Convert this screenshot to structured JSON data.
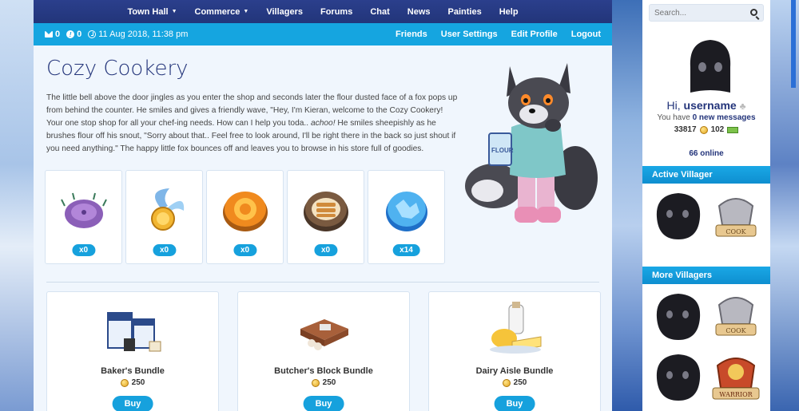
{
  "nav": {
    "items": [
      {
        "label": "Town Hall",
        "dropdown": true
      },
      {
        "label": "Commerce",
        "dropdown": true
      },
      {
        "label": "Villagers",
        "dropdown": false
      },
      {
        "label": "Forums",
        "dropdown": false
      },
      {
        "label": "Chat",
        "dropdown": false
      },
      {
        "label": "News",
        "dropdown": false
      },
      {
        "label": "Painties",
        "dropdown": false
      },
      {
        "label": "Help",
        "dropdown": false
      }
    ]
  },
  "subbar": {
    "messages_count": "0",
    "alerts_count": "0",
    "datetime": "11 Aug 2018, 11:38 pm",
    "links": [
      "Friends",
      "User Settings",
      "Edit Profile",
      "Logout"
    ]
  },
  "shop": {
    "title": "Cozy Cookery",
    "intro_1": "The little bell above the door jingles as you enter the shop and seconds later the flour dusted face of a fox pops up from behind the counter. He smiles and gives a friendly wave, \"Hey, I'm Kieran, welcome to the Cozy Cookery! Your one stop shop for all your chef-ing needs. How can I help you toda.. ",
    "intro_sneeze": "achoo!",
    "intro_2": " He smiles sheepishly as he brushes flour off his snout, \"Sorry about that.. Feel free to look around, I'll be right there in the back so just shout if you need anything.\" The happy little fox bounces off and leaves you to browse in his store full of goodies.",
    "items": [
      {
        "name": "sea-urchin-item",
        "count": "x0"
      },
      {
        "name": "winged-coin-item",
        "count": "x0"
      },
      {
        "name": "sun-coin-item",
        "count": "x0"
      },
      {
        "name": "cookie-coin-item",
        "count": "x0"
      },
      {
        "name": "ice-coin-item",
        "count": "x14"
      }
    ],
    "bundles": [
      {
        "name": "Baker's Bundle",
        "price": "250",
        "button": "Buy"
      },
      {
        "name": "Butcher's Block Bundle",
        "price": "250",
        "button": "Buy"
      },
      {
        "name": "Dairy Aisle Bundle",
        "price": "250",
        "button": "Buy"
      }
    ]
  },
  "sidebar": {
    "search_placeholder": "Search...",
    "greeting": "Hi, ",
    "username": "username",
    "messages_prefix": "You have ",
    "messages_link": "0 new messages",
    "gold": "33817",
    "cash": "102",
    "online": "66 online",
    "active_villager_heading": "Active Villager",
    "more_villagers_heading": "More Villagers",
    "badges": {
      "cook": "COOK",
      "warrior": "WARRIOR"
    }
  },
  "colors": {
    "nav_bg": "#2b3f8c",
    "subbar_bg": "#15a5e0",
    "title": "#23347a",
    "button": "#16a1dd"
  }
}
